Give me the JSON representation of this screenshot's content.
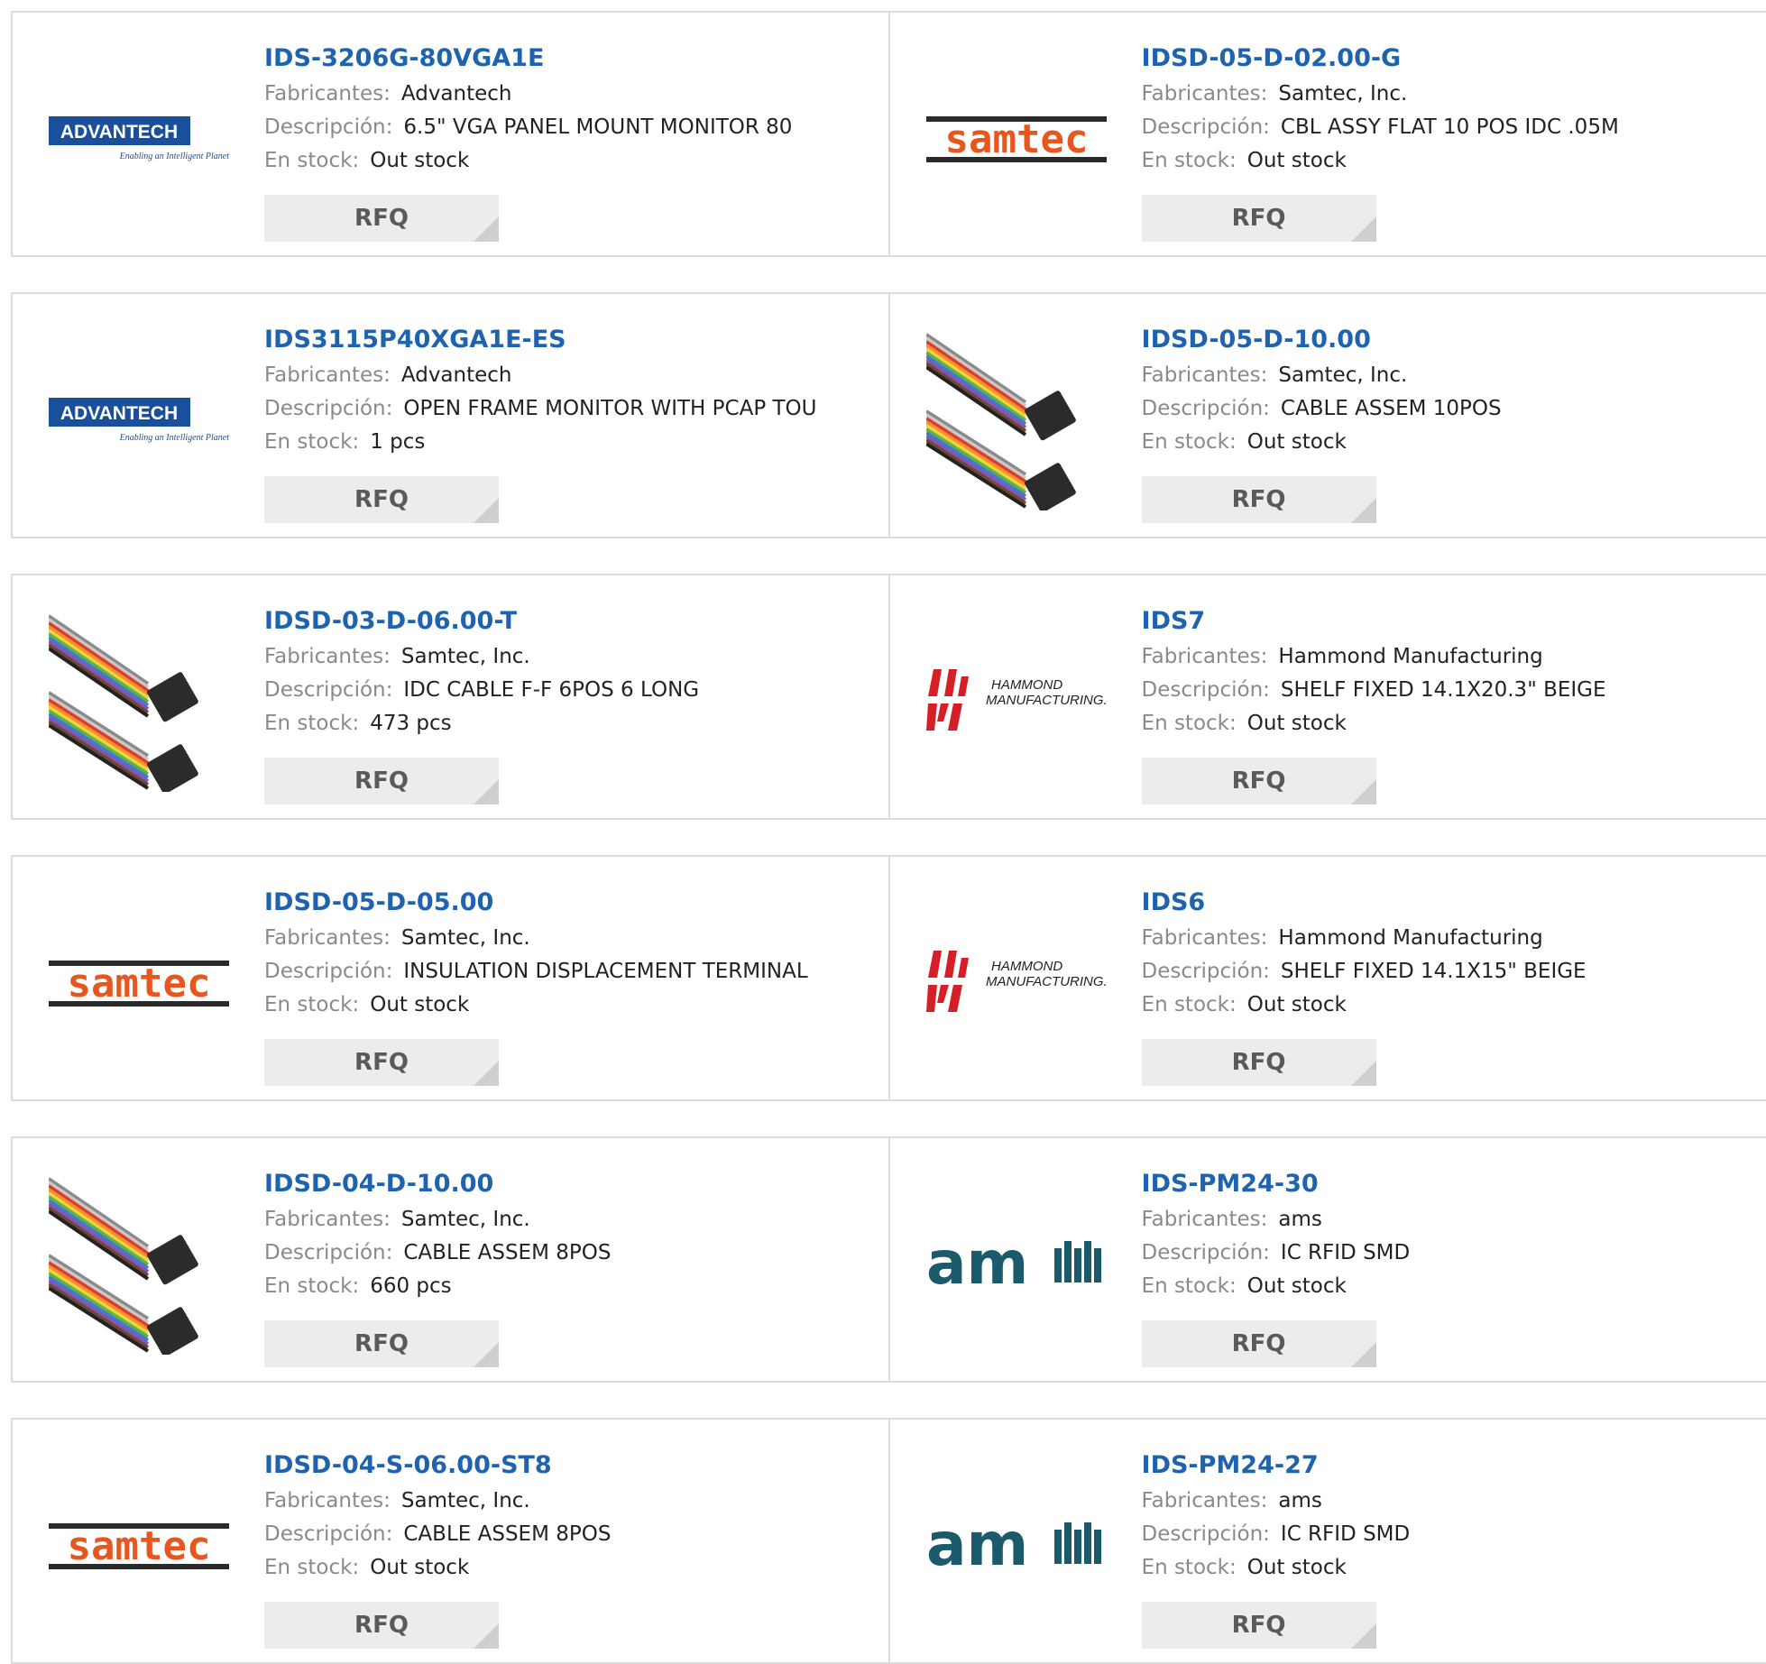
{
  "labels": {
    "manufacturer": "Fabricantes:",
    "description": "Descripción:",
    "stock": "En stock:",
    "rfq": "RFQ"
  },
  "rows": [
    [
      {
        "pn": "IDS-3206G-80VGA1E",
        "mfr": "Advantech",
        "desc": "6.5\" VGA PANEL MOUNT MONITOR 80",
        "stock": "Out stock",
        "logo": "advantech",
        "logo_text": "ADVANTECH",
        "logo_tagline": "Enabling an Intelligent Planet"
      },
      {
        "pn": "IDSD-05-D-02.00-G",
        "mfr": "Samtec, Inc.",
        "desc": "CBL ASSY FLAT 10 POS IDC .05M",
        "stock": "Out stock",
        "logo": "samtec",
        "logo_text": "samtec"
      }
    ],
    [
      {
        "pn": "IDS3115P40XGA1E-ES",
        "mfr": "Advantech",
        "desc": "OPEN FRAME MONITOR WITH PCAP TOU",
        "stock": "1 pcs",
        "logo": "advantech",
        "logo_text": "ADVANTECH",
        "logo_tagline": "Enabling an Intelligent Planet"
      },
      {
        "pn": "IDSD-05-D-10.00",
        "mfr": "Samtec, Inc.",
        "desc": "CABLE ASSEM 10POS",
        "stock": "Out stock",
        "logo": "cable-photo"
      }
    ],
    [
      {
        "pn": "IDSD-03-D-06.00-T",
        "mfr": "Samtec, Inc.",
        "desc": "IDC CABLE F-F 6POS 6 LONG",
        "stock": "473 pcs",
        "logo": "cable-photo"
      },
      {
        "pn": "IDS7",
        "mfr": "Hammond Manufacturing",
        "desc": "SHELF FIXED 14.1X20.3\" BEIGE",
        "stock": "Out stock",
        "logo": "hammond",
        "logo_text": "HAMMOND",
        "logo_text2": "MANUFACTURING."
      }
    ],
    [
      {
        "pn": "IDSD-05-D-05.00",
        "mfr": "Samtec, Inc.",
        "desc": "INSULATION DISPLACEMENT TERMINAL",
        "stock": "Out stock",
        "logo": "samtec",
        "logo_text": "samtec"
      },
      {
        "pn": "IDS6",
        "mfr": "Hammond Manufacturing",
        "desc": "SHELF FIXED 14.1X15\" BEIGE",
        "stock": "Out stock",
        "logo": "hammond",
        "logo_text": "HAMMOND",
        "logo_text2": "MANUFACTURING."
      }
    ],
    [
      {
        "pn": "IDSD-04-D-10.00",
        "mfr": "Samtec, Inc.",
        "desc": "CABLE ASSEM 8POS",
        "stock": "660 pcs",
        "logo": "cable-photo"
      },
      {
        "pn": "IDS-PM24-30",
        "mfr": "ams",
        "desc": "IC RFID SMD",
        "stock": "Out stock",
        "logo": "ams",
        "logo_text": "am"
      }
    ],
    [
      {
        "pn": "IDSD-04-S-06.00-ST8",
        "mfr": "Samtec, Inc.",
        "desc": "CABLE ASSEM 8POS",
        "stock": "Out stock",
        "logo": "samtec",
        "logo_text": "samtec"
      },
      {
        "pn": "IDS-PM24-27",
        "mfr": "ams",
        "desc": "IC RFID SMD",
        "stock": "Out stock",
        "logo": "ams",
        "logo_text": "am"
      }
    ]
  ],
  "colors": {
    "link": "#1f62ad",
    "advantech_blue": "#1a4f9b",
    "samtec_orange": "#e8561e",
    "hammond_red": "#d41f26",
    "ams_teal": "#1b5a6b"
  }
}
